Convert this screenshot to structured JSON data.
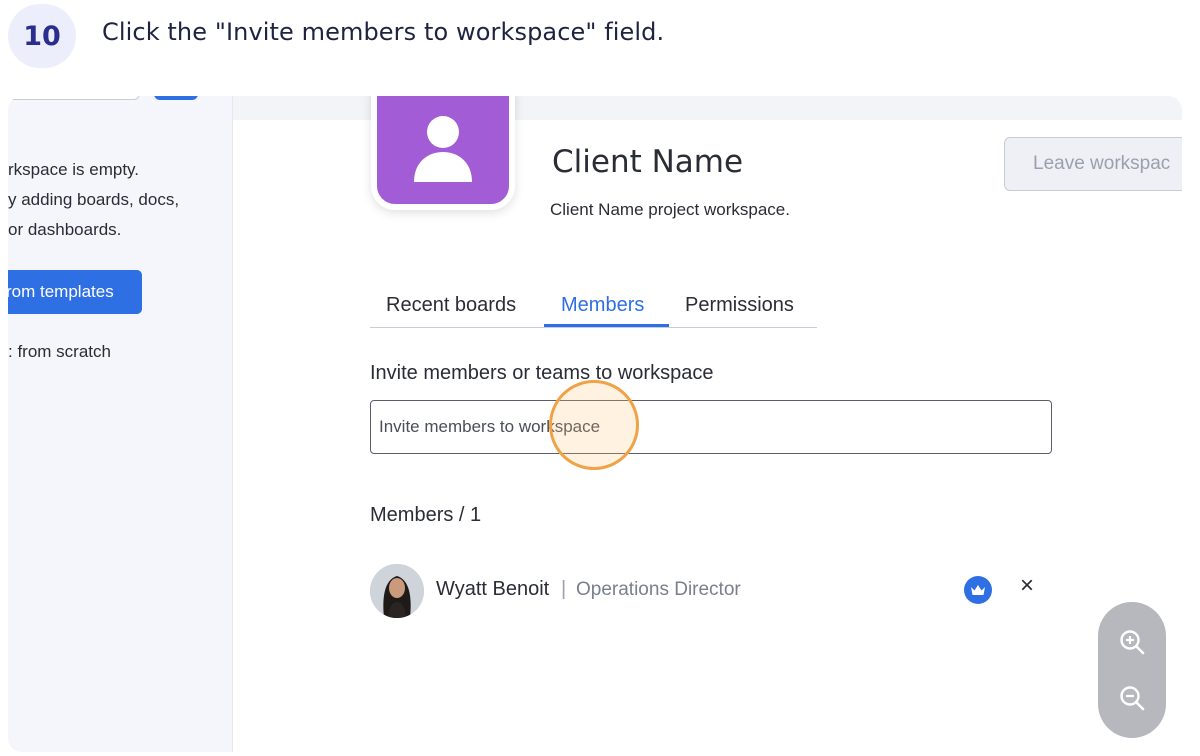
{
  "step": {
    "number": "10",
    "instruction": "Click the \"Invite members to workspace\" field."
  },
  "sidebar": {
    "empty_line1": "rkspace is empty.",
    "empty_line2": "y adding boards, docs,",
    "empty_line3": " or dashboards.",
    "templates_button": "rom templates",
    "scratch_link": ": from scratch"
  },
  "workspace": {
    "avatar_icon": "person-icon",
    "avatar_color": "#a25dd6",
    "title": "Client Name",
    "description": "Client Name project workspace.",
    "leave_button": "Leave workspac"
  },
  "tabs": [
    {
      "label": "Recent boards"
    },
    {
      "label": "Members",
      "active": true
    },
    {
      "label": "Permissions"
    }
  ],
  "invite": {
    "label": "Invite members or teams to workspace",
    "placeholder": "Invite members to workspace"
  },
  "members": {
    "count_label": "Members  /  1",
    "list": [
      {
        "name": "Wyatt Benoit",
        "separator": "|",
        "role": "Operations Director",
        "badge_icon": "crown-icon",
        "remove_icon": "×"
      }
    ]
  },
  "zoom": {
    "in_icon": "zoom-in-icon",
    "out_icon": "zoom-out-icon"
  },
  "colors": {
    "accent": "#2f6fe4",
    "highlight": "#f0a247"
  }
}
